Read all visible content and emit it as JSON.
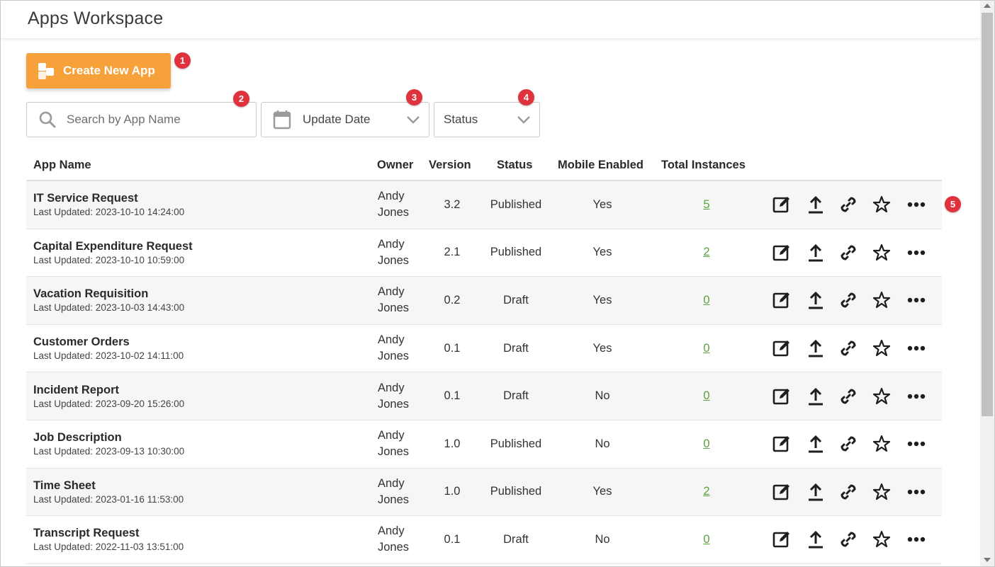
{
  "header": {
    "title": "Apps Workspace"
  },
  "toolbar": {
    "create_label": "Create New App"
  },
  "filters": {
    "search_placeholder": "Search by App Name",
    "date_select": "Update Date",
    "status_select": "Status"
  },
  "callouts": [
    "1",
    "2",
    "3",
    "4",
    "5"
  ],
  "table": {
    "columns": {
      "app_name": "App Name",
      "owner": "Owner",
      "version": "Version",
      "status": "Status",
      "mobile": "Mobile Enabled",
      "instances": "Total Instances"
    },
    "rows": [
      {
        "name": "IT Service Request",
        "updated": "Last Updated: 2023-10-10 14:24:00",
        "owner_first": "Andy",
        "owner_last": "Jones",
        "version": "3.2",
        "status": "Published",
        "mobile": "Yes",
        "instances": "5"
      },
      {
        "name": "Capital Expenditure Request",
        "updated": "Last Updated: 2023-10-10 10:59:00",
        "owner_first": "Andy",
        "owner_last": "Jones",
        "version": "2.1",
        "status": "Published",
        "mobile": "Yes",
        "instances": "2"
      },
      {
        "name": "Vacation Requisition",
        "updated": "Last Updated: 2023-10-03 14:43:00",
        "owner_first": "Andy",
        "owner_last": "Jones",
        "version": "0.2",
        "status": "Draft",
        "mobile": "Yes",
        "instances": "0"
      },
      {
        "name": "Customer Orders",
        "updated": "Last Updated: 2023-10-02 14:11:00",
        "owner_first": "Andy",
        "owner_last": "Jones",
        "version": "0.1",
        "status": "Draft",
        "mobile": "Yes",
        "instances": "0"
      },
      {
        "name": "Incident Report",
        "updated": "Last Updated: 2023-09-20 15:26:00",
        "owner_first": "Andy",
        "owner_last": "Jones",
        "version": "0.1",
        "status": "Draft",
        "mobile": "No",
        "instances": "0"
      },
      {
        "name": "Job Description",
        "updated": "Last Updated: 2023-09-13 10:30:00",
        "owner_first": "Andy",
        "owner_last": "Jones",
        "version": "1.0",
        "status": "Published",
        "mobile": "No",
        "instances": "0"
      },
      {
        "name": "Time Sheet",
        "updated": "Last Updated: 2023-01-16 11:53:00",
        "owner_first": "Andy",
        "owner_last": "Jones",
        "version": "1.0",
        "status": "Published",
        "mobile": "Yes",
        "instances": "2"
      },
      {
        "name": "Transcript Request",
        "updated": "Last Updated: 2022-11-03 13:51:00",
        "owner_first": "Andy",
        "owner_last": "Jones",
        "version": "0.1",
        "status": "Draft",
        "mobile": "No",
        "instances": "0"
      }
    ],
    "row_actions": [
      "edit-icon",
      "upload-icon",
      "link-icon",
      "star-icon",
      "more-icon"
    ]
  },
  "colors": {
    "accent": "#f7a13a",
    "callout": "#e0323d",
    "instances_link": "#5aa23c",
    "row_stripe": "#f6f6f6"
  }
}
